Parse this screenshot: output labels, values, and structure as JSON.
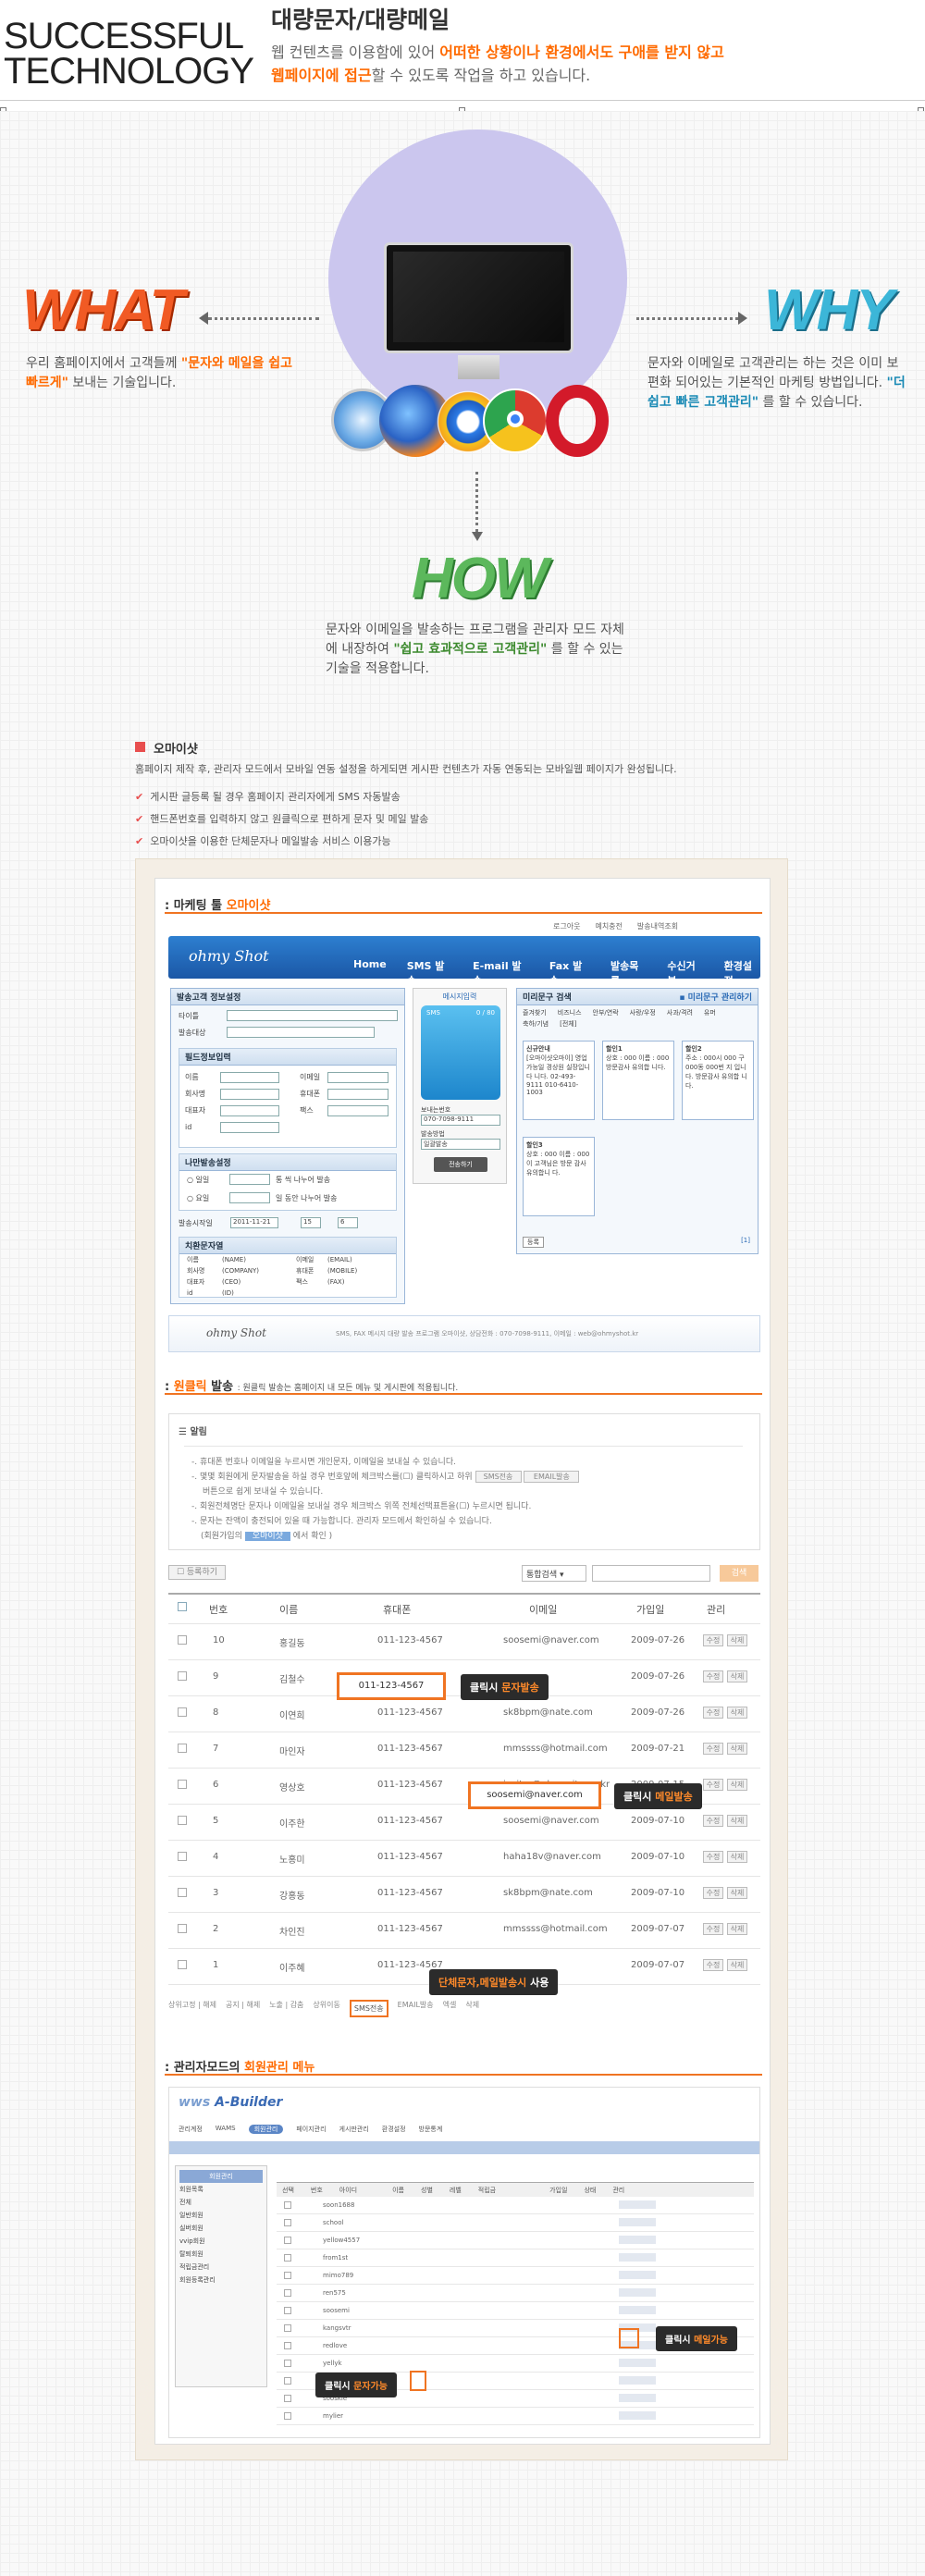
{
  "header": {
    "brand_line1": "SUCCESSFUL",
    "brand_line2": "TECHNOLOGY",
    "title": "대량문자/대량메일",
    "desc_1": "웹 컨텐츠를 이용함에 있어 ",
    "desc_1_hl": "어떠한 상황이나 환경에서도 구애를 받지 않고",
    "desc_2_hl": "웹페이지에 접근",
    "desc_2": "할 수 있도록 작업을 하고 있습니다."
  },
  "what": {
    "title": "WHAT",
    "text_1": "우리 홈페이지에서 고객들께 ",
    "text_hl": "\"문자와 메일을 쉽고 빠르게\"",
    "text_2": " 보내는 기술입니다."
  },
  "why": {
    "title": "WHY",
    "text_1": "문자와 이메일로 고객관리는 하는 것은 이미 보편화 되어있는 기본적인 마케팅 방법입니다. ",
    "text_hl": "\"더 쉽고 빠른 고객관리\"",
    "text_2": " 를 할 수 있습니다."
  },
  "how": {
    "title": "HOW",
    "text_1": "문자와 이메일을 발송하는 프로그램을 관리자 모드 자체에 내장하여 ",
    "text_hl": "\"쉽고 효과적으로 고객관리\"",
    "text_2": " 를 할 수 있는 기술을 적용합니다."
  },
  "omai": {
    "title": "오마이샷",
    "desc": "홈페이지 제작 후, 관리자 모드에서 모바일 연동 설정을 하게되면 게시판 컨텐츠가 자동 연동되는 모바일웹 페이지가 완성됩니다.",
    "checks": [
      "게시판 글등록 될 경우 홈페이지 관리자에게 SMS 자동발송",
      "핸드폰번호를 입력하지 않고 원클릭으로 편하게 문자 및 메일 발송",
      "오마이샷을 이용한 단체문자나 메일발송 서비스 이용가능"
    ]
  },
  "marketing": {
    "title_pre": ": 마케팅 툴 ",
    "title_hl": "오마이샷",
    "toplinks": [
      "로그아웃",
      "예치충전",
      "발송내역조회"
    ],
    "logo": "ohmy Shot",
    "nav": [
      "Home",
      "SMS 발송",
      "E-mail 발송",
      "Fax 발송",
      "발송목록",
      "수신거부",
      "환경설정"
    ],
    "panels": {
      "sender": "발송고객 정보설정",
      "sender_fields": [
        "타이틀",
        "발송대상"
      ],
      "info": "필드정보입력",
      "info_labels": [
        "이름",
        "이메일",
        "회사명",
        "휴대폰",
        "대표자",
        "팩스",
        "id"
      ],
      "reserve": "나만발송설정",
      "reserve_opts": [
        "일일",
        "요일"
      ],
      "reserve_texts": [
        "통 씩 나누어 발송",
        "일 동안 나누어 발송"
      ],
      "send_time_label": "발송시작일",
      "send_date": "2011-11-21",
      "send_hour": "15",
      "send_min": "6",
      "sub": "치환문자열",
      "sub_rows": [
        [
          "이름",
          "(NAME)",
          "이메일",
          "(EMAIL)"
        ],
        [
          "회사명",
          "(COMPANY)",
          "휴대폰",
          "(MOBILE)"
        ],
        [
          "대표자",
          "(CEO)",
          "팩스",
          "(FAX)"
        ],
        [
          "id",
          "(ID)",
          "",
          ""
        ]
      ],
      "phone_head": "메시지입력",
      "phone_bytes": "0 / 80",
      "phone_label": "SMS",
      "callback_label": "보내는번호",
      "callback": "070-7098-9111",
      "send_method_label": "발송방법",
      "send_method": "일괄발송",
      "send_button": "전송하기",
      "template_head": "미리문구 검색",
      "template_link": "▪ 미리문구 관리하기",
      "template_tabs": [
        "즐겨찾기",
        "비즈니스",
        "안부/연락",
        "사랑/우정",
        "사과/격려",
        "유머",
        "축하/기념",
        "[전체]"
      ],
      "templates": [
        {
          "title": "신규안내",
          "body": "[오마이샷오마이] 영업가능일 경상원 실장입니다 니다. 02-493-9111 010-6410-1003"
        },
        {
          "title": "할인1",
          "body": "상호 : 000 이름 : 000 방문감사 유의합 니다."
        },
        {
          "title": "할인2",
          "body": "주소 : 000시 000 구 000동 000번 지 입니다. 방문감사 유의합 니다."
        },
        {
          "title": "할인3",
          "body": "상호 : 000 이름 : 000 이 고객님은 방문 감사 유의합니 다."
        }
      ],
      "template_reg": "등록",
      "template_page": "[1]",
      "template_btns": [
        "수정",
        "삭제"
      ]
    },
    "footer_logo": "ohmy Shot",
    "footer_text": "SMS, FAX 메시지 대량 발송 프로그램 오마이샷, 상담전화 : 070-7098-9111, 이메일 : web@ohmyshot.kr"
  },
  "oneclick": {
    "title_pre": ": ",
    "title_hl": "원클릭",
    "title_rest": " 발송",
    "subtitle": ": 원클릭 발송는 홈페이지 내 모든 메뉴 및 게시판에 적용됩니다.",
    "notice_title": "알림",
    "notice_lines": [
      "-. 휴대폰 번호나 이메일을 누르시면 개인문자, 이메일을 보내실 수 있습니다.",
      "-. 몇몇 회원에게 문자발송을 하실 경우 번호앞에 체크박스를(☐) 클릭하시고 하위",
      "버튼으로 쉽게 보내실 수 있습니다.",
      "-. 회원전체명단 문자나 이메일을 보내실 경우 체크박스 위쪽 전체선택표튼을(☐) 누르시면 됩니다.",
      "-. 문자는 잔액이 충전되어 있을 때 가능합니다. 관리자 모드에서 확인하실 수 있습니다.",
      "(회원가입의",
      "에서 확인 )"
    ],
    "notice_btns": [
      "SMS전송",
      "EMAIL발송"
    ],
    "notice_link": "오마이샷",
    "register_btn": "등록하기",
    "search_select": "통합검색",
    "search_btn": "검색",
    "columns": [
      "번호",
      "이름",
      "휴대폰",
      "이메일",
      "가입일",
      "관리"
    ],
    "rows": [
      [
        "10",
        "홍길동",
        "011-123-4567",
        "soosemi@naver.com",
        "2009-07-26"
      ],
      [
        "9",
        "김철수",
        "011-123-4567",
        "",
        "2009-07-26"
      ],
      [
        "8",
        "이연희",
        "011-123-4567",
        "sk8bpm@nate.com",
        "2009-07-26"
      ],
      [
        "7",
        "마인자",
        "011-123-4567",
        "mmssss@hotmail.com",
        "2009-07-21"
      ],
      [
        "6",
        "영상호",
        "011-123-4567",
        "insiter@ohmysite.co.kr",
        "2009-07-15"
      ],
      [
        "5",
        "이주한",
        "011-123-4567",
        "soosemi@naver.com",
        "2009-07-10"
      ],
      [
        "4",
        "노홍미",
        "011-123-4567",
        "haha18v@naver.com",
        "2009-07-10"
      ],
      [
        "3",
        "강홍동",
        "011-123-4567",
        "sk8bpm@nate.com",
        "2009-07-10"
      ],
      [
        "2",
        "차인진",
        "011-123-4567",
        "mmssss@hotmail.com",
        "2009-07-07"
      ],
      [
        "1",
        "이주혜",
        "011-123-4567",
        "",
        "2009-07-07"
      ]
    ],
    "row_btns": [
      "수정",
      "삭제"
    ],
    "callout_sms_pre": "클릭시 ",
    "callout_sms_hl": "문자발송",
    "callout_mail_pre": "클릭시 ",
    "callout_mail_hl": "메일발송",
    "callout_group_pre": "",
    "callout_group_hl": "단체문자,메일발송시",
    "callout_group_post": " 사용",
    "bottom_btns": [
      "상위고정 | 해제",
      "공지 | 해제",
      "노출 | 감춤",
      "상위이동",
      "SMS전송",
      "EMAIL발송",
      "엑셀",
      "삭제"
    ]
  },
  "admin": {
    "title_pre": ": 관리자모드의 ",
    "title_hl": "회원관리 메뉴",
    "logo_1": "wws",
    "logo_2": "A-Builder",
    "tabs": [
      "관리계정",
      "WAMS",
      "회원관리",
      "페이지관리",
      "게시판관리",
      "환경설정",
      "방문통계"
    ],
    "sidemenu": [
      "회원관리",
      "회원목록",
      "전체",
      "일반회원",
      "실버회원",
      "vvip회원",
      "탈퇴회원",
      "적립금관리",
      "회원등록관리"
    ],
    "col_heads": [
      "선택",
      "번호",
      "아이디",
      "이름",
      "성별",
      "레벨",
      "적립금",
      "",
      "",
      "",
      "",
      "가입일",
      "상태",
      "관리"
    ],
    "rows": [
      "soon1688",
      "school",
      "yellow4557",
      "from1st",
      "mimo789",
      "ren575",
      "soosemi",
      "kangsvtr",
      "redlove",
      "yellyk",
      "dune",
      "sooskie",
      "mylier"
    ],
    "callout_mail_pre": "클릭시 ",
    "callout_mail_hl": "메일가능",
    "callout_sms_pre": "클릭시 ",
    "callout_sms_hl": "문자가능"
  }
}
